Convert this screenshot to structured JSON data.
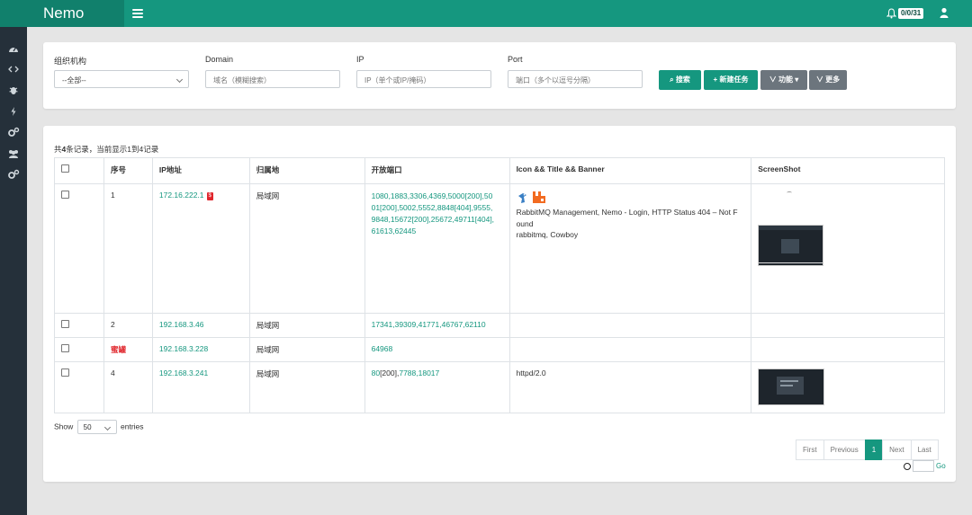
{
  "app": {
    "brand": "Nemo",
    "notify_badge": "0/0/31"
  },
  "icons": {
    "menu": "hamburger-icon",
    "bell": "bell-icon",
    "user": "user-icon",
    "sidebar": [
      "dashboard-icon",
      "code-icon",
      "bug-icon",
      "bolt-icon",
      "cogs-icon",
      "users-icon",
      "settings-icon"
    ]
  },
  "filters": {
    "org": {
      "label": "组织机构",
      "value": "--全部--"
    },
    "domain": {
      "label": "Domain",
      "placeholder": "域名（模糊搜索）"
    },
    "ip": {
      "label": "IP",
      "placeholder": "IP（单个或IP/掩码）"
    },
    "port": {
      "label": "Port",
      "placeholder": "端口（多个以逗号分隔）"
    }
  },
  "buttons": {
    "search": "搜索",
    "new_task": "新建任务",
    "function": "功能",
    "more": "更多"
  },
  "summary": {
    "prefix": "共",
    "count": "4",
    "suffix": "条记录，当前显示1到4记录"
  },
  "table": {
    "headers": {
      "index": "序号",
      "ip": "IP地址",
      "location": "归属地",
      "ports": "开放端口",
      "banner": "Icon && Title && Banner",
      "screenshot": "ScreenShot"
    },
    "rows": [
      {
        "index": "1",
        "ip": "172.16.222.1",
        "ip_tag": "$",
        "location": "局域网",
        "ports_line1": "1080,1883,3306,4369,5000[200],50",
        "ports_line2": "01[200],5002,5552,8848[404],9555,",
        "ports_line3": "9848,15672[200],25672,49711[404],",
        "ports_line4": "61613,62445",
        "banner_title_line1": "RabbitMQ Management, Nemo - Login, HTTP Status 404 – Not F",
        "banner_title_line2": "ound",
        "banner_info": "rabbitmq, Cowboy"
      },
      {
        "index": "2",
        "ip": "192.168.3.46",
        "location": "局域网",
        "ports": "17341,39309,41771,46767,62110"
      },
      {
        "index": "蜜罐",
        "ip": "192.168.3.228",
        "location": "局域网",
        "ports": "64968"
      },
      {
        "index": "4",
        "ip": "192.168.3.241",
        "location": "局域网",
        "ports_a": "80",
        "ports_b": "[200],",
        "ports_c": "7788,18017",
        "banner_info": "httpd/2.0"
      }
    ]
  },
  "length": {
    "show": "Show",
    "value": "50",
    "entries": "entries"
  },
  "pager": {
    "first": "First",
    "previous": "Previous",
    "current": "1",
    "next": "Next",
    "last": "Last",
    "go": "Go"
  },
  "colors": {
    "brand": "#15977f",
    "sidebar": "#25303a",
    "danger": "#e0262c"
  }
}
